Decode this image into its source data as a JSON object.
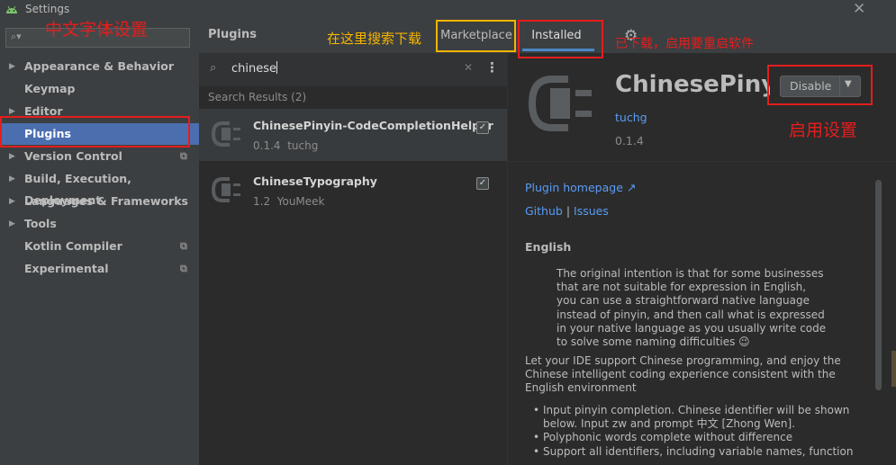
{
  "window": {
    "title": "Settings",
    "close_glyph": "✕"
  },
  "sidebar": {
    "search_placeholder": "",
    "items": [
      {
        "label": "Appearance & Behavior",
        "expandable": true,
        "has_config_icon": false
      },
      {
        "label": "Keymap",
        "expandable": false,
        "has_config_icon": false
      },
      {
        "label": "Editor",
        "expandable": true,
        "has_config_icon": false
      },
      {
        "label": "Plugins",
        "expandable": false,
        "has_config_icon": false,
        "selected": true
      },
      {
        "label": "Version Control",
        "expandable": true,
        "has_config_icon": true
      },
      {
        "label": "Build, Execution, Deployment",
        "expandable": true,
        "has_config_icon": false
      },
      {
        "label": "Languages & Frameworks",
        "expandable": true,
        "has_config_icon": false
      },
      {
        "label": "Tools",
        "expandable": true,
        "has_config_icon": false
      },
      {
        "label": "Kotlin Compiler",
        "expandable": false,
        "has_config_icon": true
      },
      {
        "label": "Experimental",
        "expandable": false,
        "has_config_icon": true
      }
    ]
  },
  "plugins": {
    "title": "Plugins",
    "tabs": {
      "marketplace": "Marketplace",
      "installed": "Installed",
      "active": "Installed"
    },
    "search": {
      "value": "chinese"
    },
    "results_header": "Search Results (2)",
    "results": [
      {
        "name": "ChinesePinyin-CodeCompletionHelper",
        "version": "0.1.4",
        "vendor": "tuchg",
        "enabled": true,
        "selected": true
      },
      {
        "name": "ChineseTypography",
        "version": "1.2",
        "vendor": "YouMeek",
        "enabled": true,
        "selected": false
      }
    ]
  },
  "details": {
    "name": "ChinesePinyin",
    "button_label": "Disable",
    "vendor": "tuchg",
    "version": "0.1.4",
    "homepage_link": "Plugin homepage ↗",
    "github_link": "Github",
    "issues_link": "Issues",
    "separator": "|",
    "section_header": "English",
    "indented_lines": [
      "The original intention is that for some businesses",
      "that are not suitable for expression in English,",
      "you can use a straightforward native language",
      "instead of pinyin, and then call what is expressed",
      "in your native language as you usually write code",
      "to solve some naming difficulties 😉"
    ],
    "paragraph_lines": [
      "Let your IDE support Chinese programming, and enjoy the",
      "Chinese intelligent coding experience consistent with the",
      "English environment"
    ],
    "bullets": [
      "Input pinyin completion. Chinese identifier will be shown",
      "below. Input zw and prompt 中文 [Zhong Wen].",
      "Polyphonic words complete without difference",
      "Support all identifiers, including variable names, function"
    ]
  },
  "annotations": {
    "font_settings": "中文字体设置",
    "search_here": "在这里搜索下载",
    "installed_note": "已下载，启用要重启软件",
    "enable_settings": "启用设置"
  },
  "colors": {
    "selection": "#4b6eaf",
    "link": "#589df6",
    "annotation_red": "#e51d1d",
    "annotation_yellow": "#f7b500",
    "tab_underline": "#4a88c7"
  },
  "icons": [
    "android-icon",
    "search-icon",
    "chevron-right-icon",
    "config-icon",
    "gear-icon",
    "plugin-plug-icon",
    "close-icon",
    "more-vert-icon",
    "checkbox-icon",
    "dropdown-arrow-icon"
  ]
}
